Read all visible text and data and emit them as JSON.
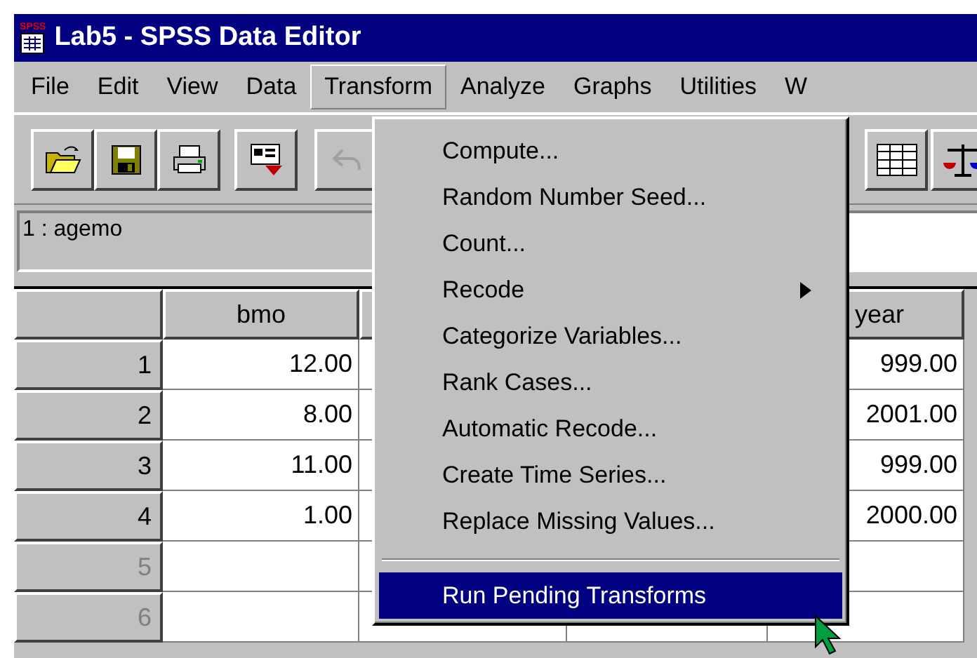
{
  "window": {
    "icon_label": "SPSS",
    "title": "Lab5 - SPSS Data Editor"
  },
  "menu_bar": [
    {
      "label": "File",
      "selected": false
    },
    {
      "label": "Edit",
      "selected": false
    },
    {
      "label": "View",
      "selected": false
    },
    {
      "label": "Data",
      "selected": false
    },
    {
      "label": "Transform",
      "selected": true
    },
    {
      "label": "Analyze",
      "selected": false
    },
    {
      "label": "Graphs",
      "selected": false
    },
    {
      "label": "Utilities",
      "selected": false
    },
    {
      "label": "W",
      "selected": false
    }
  ],
  "toolbar": [
    {
      "kind": "open",
      "disabled": false
    },
    {
      "kind": "save",
      "disabled": false
    },
    {
      "kind": "print",
      "disabled": false
    },
    {
      "kind": "recall",
      "disabled": false
    },
    {
      "kind": "undo",
      "disabled": true
    },
    {
      "kind": "grid",
      "disabled": false
    },
    {
      "kind": "scale",
      "disabled": false
    }
  ],
  "cell_editor": {
    "label": "1 : agemo"
  },
  "grid": {
    "columns": [
      "bmo",
      "year"
    ],
    "rows": [
      {
        "number": "1",
        "has_data": true,
        "bmo": "12.00",
        "year": "999.00"
      },
      {
        "number": "2",
        "has_data": true,
        "bmo": "8.00",
        "year": "2001.00"
      },
      {
        "number": "3",
        "has_data": true,
        "bmo": "11.00",
        "year": "999.00"
      },
      {
        "number": "4",
        "has_data": true,
        "bmo": "1.00",
        "year": "2000.00"
      },
      {
        "number": "5",
        "has_data": false
      },
      {
        "number": "6",
        "has_data": false
      }
    ]
  },
  "dropdown": {
    "items": [
      {
        "kind": "item",
        "label": "Compute...",
        "selected": false
      },
      {
        "kind": "item",
        "label": "Random Number Seed...",
        "selected": false
      },
      {
        "kind": "item",
        "label": "Count...",
        "selected": false
      },
      {
        "kind": "submenu",
        "label": "Recode",
        "selected": false
      },
      {
        "kind": "item",
        "label": "Categorize Variables...",
        "selected": false
      },
      {
        "kind": "item",
        "label": "Rank Cases...",
        "selected": false
      },
      {
        "kind": "item",
        "label": "Automatic Recode...",
        "selected": false
      },
      {
        "kind": "item",
        "label": "Create Time Series...",
        "selected": false
      },
      {
        "kind": "item",
        "label": "Replace Missing Values...",
        "selected": false
      },
      {
        "kind": "separator"
      },
      {
        "kind": "item",
        "label": "Run Pending Transforms",
        "selected": true
      }
    ]
  }
}
